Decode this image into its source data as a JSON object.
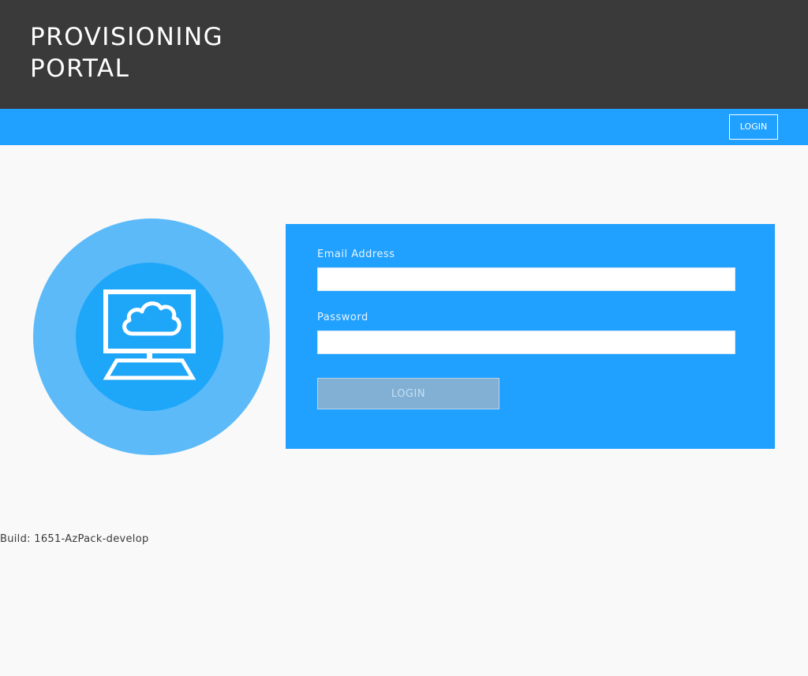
{
  "header": {
    "title_line1": "PROVISIONING",
    "title_line2": "PORTAL",
    "background": "#3a3a3a"
  },
  "navbar": {
    "login_label": "LOGIN",
    "background": "#20a0ff"
  },
  "hero": {
    "icon": "monitor-cloud-icon",
    "outer_color": "#5cbaf9",
    "inner_color": "#1ea7f9"
  },
  "login_form": {
    "email_label": "Email Address",
    "email_value": "",
    "password_label": "Password",
    "password_value": "",
    "submit_label": "LOGIN",
    "panel_color": "#20a0ff"
  },
  "footer": {
    "build_text": "Build: 1651-AzPack-develop"
  }
}
